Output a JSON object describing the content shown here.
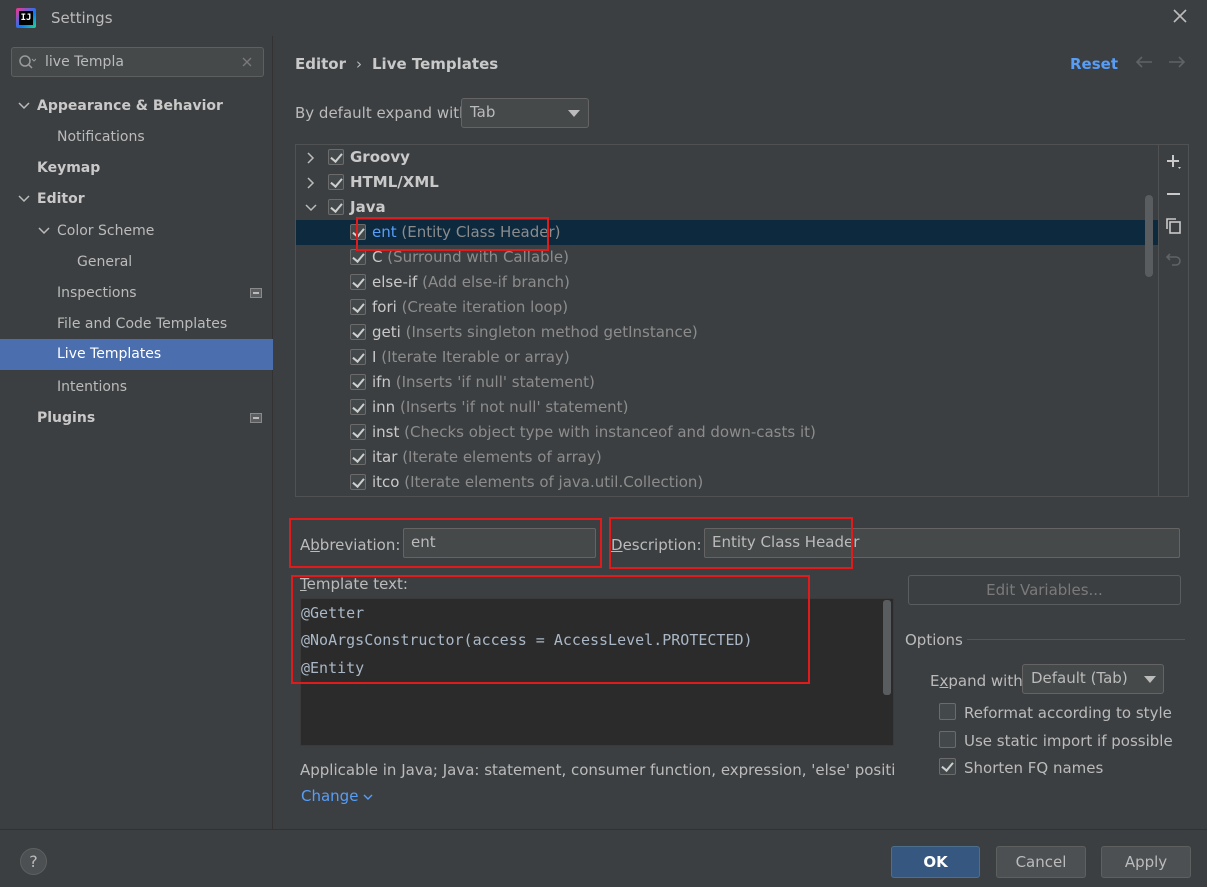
{
  "window": {
    "title": "Settings",
    "logo_text": "IJ"
  },
  "search": {
    "value": "live Templa"
  },
  "sidebar": {
    "items": [
      {
        "label": "Appearance & Behavior"
      },
      {
        "label": "Notifications"
      },
      {
        "label": "Keymap"
      },
      {
        "label": "Editor"
      },
      {
        "label": "Color Scheme"
      },
      {
        "label": "General"
      },
      {
        "label": "Inspections"
      },
      {
        "label": "File and Code Templates"
      },
      {
        "label": "Live Templates"
      },
      {
        "label": "Intentions"
      },
      {
        "label": "Plugins"
      }
    ]
  },
  "header": {
    "breadcrumb": [
      "Editor",
      "Live Templates"
    ],
    "breadcrumb_sep": "›",
    "reset": "Reset"
  },
  "expand": {
    "label": "By default expand with",
    "value": "Tab"
  },
  "templates": {
    "groups": [
      {
        "name": "Groovy"
      },
      {
        "name": "HTML/XML"
      },
      {
        "name": "Java"
      }
    ],
    "items": [
      {
        "abbr": "ent",
        "desc": "(Entity Class Header)"
      },
      {
        "abbr": "C",
        "desc": "(Surround with Callable)"
      },
      {
        "abbr": "else-if",
        "desc": "(Add else-if branch)"
      },
      {
        "abbr": "fori",
        "desc": "(Create iteration loop)"
      },
      {
        "abbr": "geti",
        "desc": "(Inserts singleton method getInstance)"
      },
      {
        "abbr": "I",
        "desc": "(Iterate Iterable or array)"
      },
      {
        "abbr": "ifn",
        "desc": "(Inserts 'if null' statement)"
      },
      {
        "abbr": "inn",
        "desc": "(Inserts 'if not null' statement)"
      },
      {
        "abbr": "inst",
        "desc": "(Checks object type with instanceof and down-casts it)"
      },
      {
        "abbr": "itar",
        "desc": "(Iterate elements of array)"
      },
      {
        "abbr": "itco",
        "desc": "(Iterate elements of java.util.Collection)"
      }
    ]
  },
  "editor": {
    "abbreviation_label_pre": "A",
    "abbreviation_label_mnemonic": "b",
    "abbreviation_label_post": "breviation:",
    "abbreviation_value": "ent",
    "description_label_mnemonic": "D",
    "description_label_post": "escription:",
    "description_value": "Entity Class Header",
    "template_label_mnemonic": "T",
    "template_label_post": "emplate text:",
    "template_lines": [
      "@Getter",
      "@NoArgsConstructor(access = AccessLevel.PROTECTED)",
      "@Entity"
    ],
    "edit_variables": "Edit Variables...",
    "applicable": "Applicable in Java; Java: statement, consumer function, expression, 'else' position, declar",
    "change": "Change"
  },
  "options": {
    "title": "Options",
    "expand_label_pre": "E",
    "expand_label_mnemonic": "x",
    "expand_label_post": "pand with",
    "expand_value": "Default (Tab)",
    "reformat": "Reformat according to style",
    "static_import": "Use static import if possible",
    "shorten_fq": "Shorten FQ names"
  },
  "footer": {
    "help": "?",
    "ok": "OK",
    "cancel": "Cancel",
    "apply": "Apply"
  },
  "colors": {
    "accent": "#4b6eaf",
    "link": "#589df6",
    "highlight": "#e01b1b"
  }
}
